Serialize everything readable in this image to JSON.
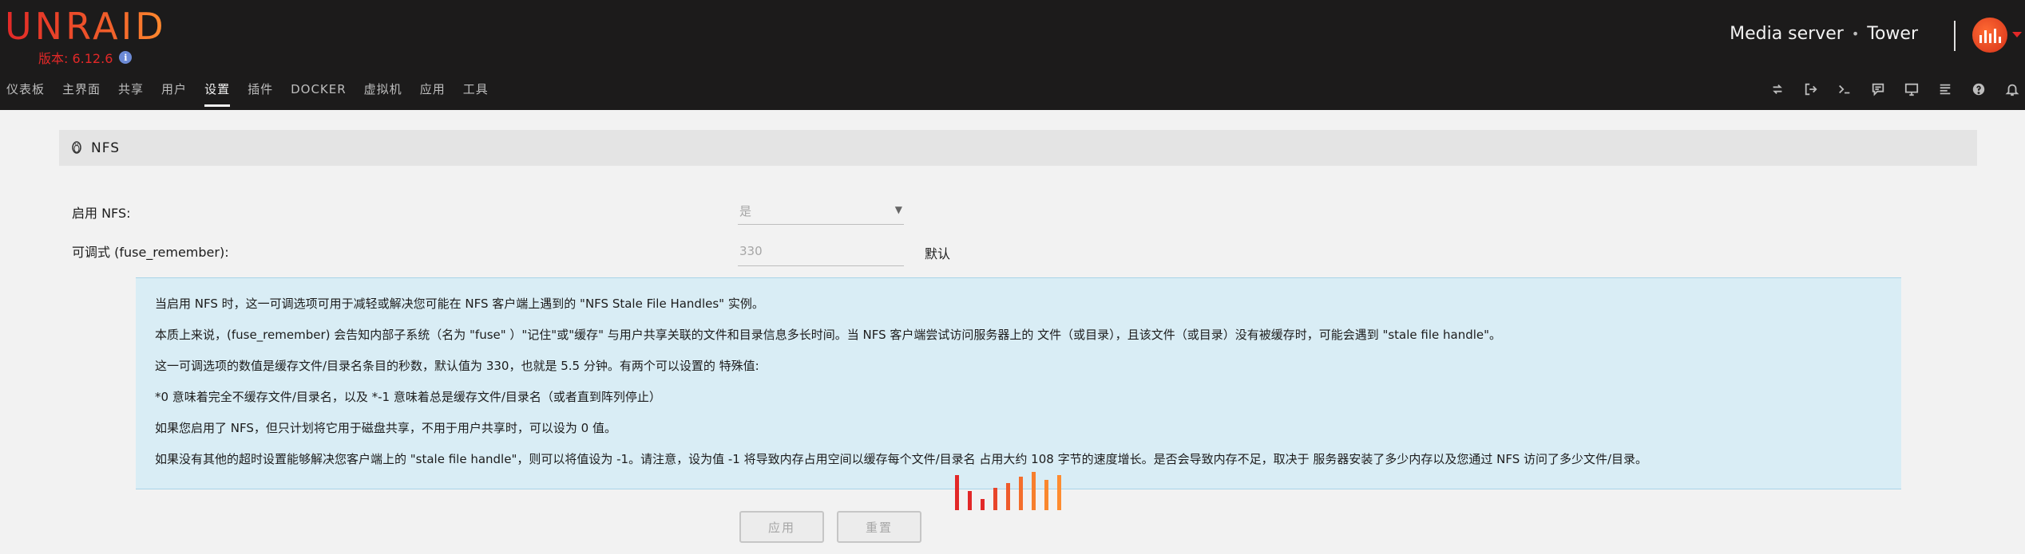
{
  "brand": {
    "logo": "UNRAID",
    "version": "版本: 6.12.6"
  },
  "server": {
    "description": "Media server",
    "separator": "•",
    "name": "Tower"
  },
  "nav": {
    "items": [
      {
        "label": "仪表板",
        "active": false
      },
      {
        "label": "主界面",
        "active": false
      },
      {
        "label": "共享",
        "active": false
      },
      {
        "label": "用户",
        "active": false
      },
      {
        "label": "设置",
        "active": true
      },
      {
        "label": "插件",
        "active": false
      },
      {
        "label": "DOCKER",
        "active": false
      },
      {
        "label": "虚拟机",
        "active": false
      },
      {
        "label": "应用",
        "active": false
      },
      {
        "label": "工具",
        "active": false
      }
    ]
  },
  "toolbar_icons": [
    "sync-icon",
    "logout-icon",
    "terminal-icon",
    "feedback-icon",
    "monitor-icon",
    "log-icon",
    "help-icon",
    "notification-bell-icon"
  ],
  "section": {
    "title": "NFS",
    "icon": "linux-penguin-icon"
  },
  "form": {
    "enable_nfs_label": "启用 NFS:",
    "enable_nfs_value": "是",
    "fuse_remember_label": "可调式 (fuse_remember):",
    "fuse_remember_placeholder": "330",
    "default_label": "默认"
  },
  "help": {
    "paragraphs": [
      "当启用 NFS 时，这一可调选项可用于减轻或解决您可能在 NFS 客户端上遇到的 \"NFS Stale File Handles\" 实例。",
      "本质上来说，(fuse_remember) 会告知内部子系统（名为 \"fuse\" ）\"记住\"或\"缓存\" 与用户共享关联的文件和目录信息多长时间。当 NFS 客户端尝试访问服务器上的 文件（或目录），且该文件（或目录）没有被缓存时，可能会遇到 \"stale file handle\"。",
      "这一可调选项的数值是缓存文件/目录名条目的秒数，默认值为 330，也就是 5.5 分钟。有两个可以设置的 特殊值:",
      "*0 意味着完全不缓存文件/目录名，以及 *-1 意味着总是缓存文件/目录名（或者直到阵列停止）",
      "如果您启用了 NFS，但只计划将它用于磁盘共享，不用于用户共享时，可以设为 0 值。",
      "如果没有其他的超时设置能够解决您客户端上的 \"stale file handle\"，则可以将值设为 -1。请注意，设为值 -1 将导致内存占用空间以缓存每个文件/目录名 占用大约 108 字节的速度增长。是否会导致内存不足，取决于 服务器安装了多少内存以及您通过 NFS 访问了多少文件/目录。"
    ]
  },
  "buttons": {
    "apply": "应用",
    "reset": "重置"
  },
  "colors": {
    "header_bg": "#1c1b1b",
    "brand_red": "#e22828",
    "brand_orange": "#ff8c2f",
    "help_bg": "#d9edf5"
  }
}
